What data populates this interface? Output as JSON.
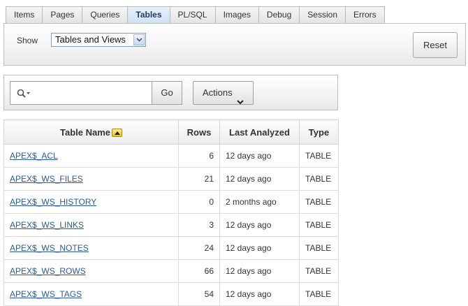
{
  "tabs": [
    {
      "label": "Items",
      "active": false
    },
    {
      "label": "Pages",
      "active": false
    },
    {
      "label": "Queries",
      "active": false
    },
    {
      "label": "Tables",
      "active": true
    },
    {
      "label": "PL/SQL",
      "active": false
    },
    {
      "label": "Images",
      "active": false
    },
    {
      "label": "Debug",
      "active": false
    },
    {
      "label": "Session",
      "active": false
    },
    {
      "label": "Errors",
      "active": false
    }
  ],
  "filter": {
    "show_label": "Show",
    "show_value": "Tables and Views",
    "reset_label": "Reset"
  },
  "search": {
    "value": "",
    "go_label": "Go",
    "actions_label": "Actions"
  },
  "table": {
    "columns": [
      "Table Name",
      "Rows",
      "Last Analyzed",
      "Type"
    ],
    "sort_column": "Table Name",
    "sort_direction": "ascending",
    "rows": [
      {
        "name": "APEX$_ACL",
        "rows": "6",
        "last_analyzed": "12 days ago",
        "type": "TABLE"
      },
      {
        "name": "APEX$_WS_FILES",
        "rows": "21",
        "last_analyzed": "12 days ago",
        "type": "TABLE"
      },
      {
        "name": "APEX$_WS_HISTORY",
        "rows": "0",
        "last_analyzed": "2 months ago",
        "type": "TABLE"
      },
      {
        "name": "APEX$_WS_LINKS",
        "rows": "3",
        "last_analyzed": "12 days ago",
        "type": "TABLE"
      },
      {
        "name": "APEX$_WS_NOTES",
        "rows": "24",
        "last_analyzed": "12 days ago",
        "type": "TABLE"
      },
      {
        "name": "APEX$_WS_ROWS",
        "rows": "66",
        "last_analyzed": "12 days ago",
        "type": "TABLE"
      },
      {
        "name": "APEX$_WS_TAGS",
        "rows": "54",
        "last_analyzed": "12 days ago",
        "type": "TABLE"
      }
    ]
  },
  "icons": {
    "search": "search-icon",
    "sort": "sort-ascending-icon",
    "actions": "chevron-down-icon",
    "select": "chevron-down-icon"
  },
  "colors": {
    "link": "#2b5a9a",
    "active_tab": "#cfe0f3",
    "sort_badge": "#f3c400"
  }
}
